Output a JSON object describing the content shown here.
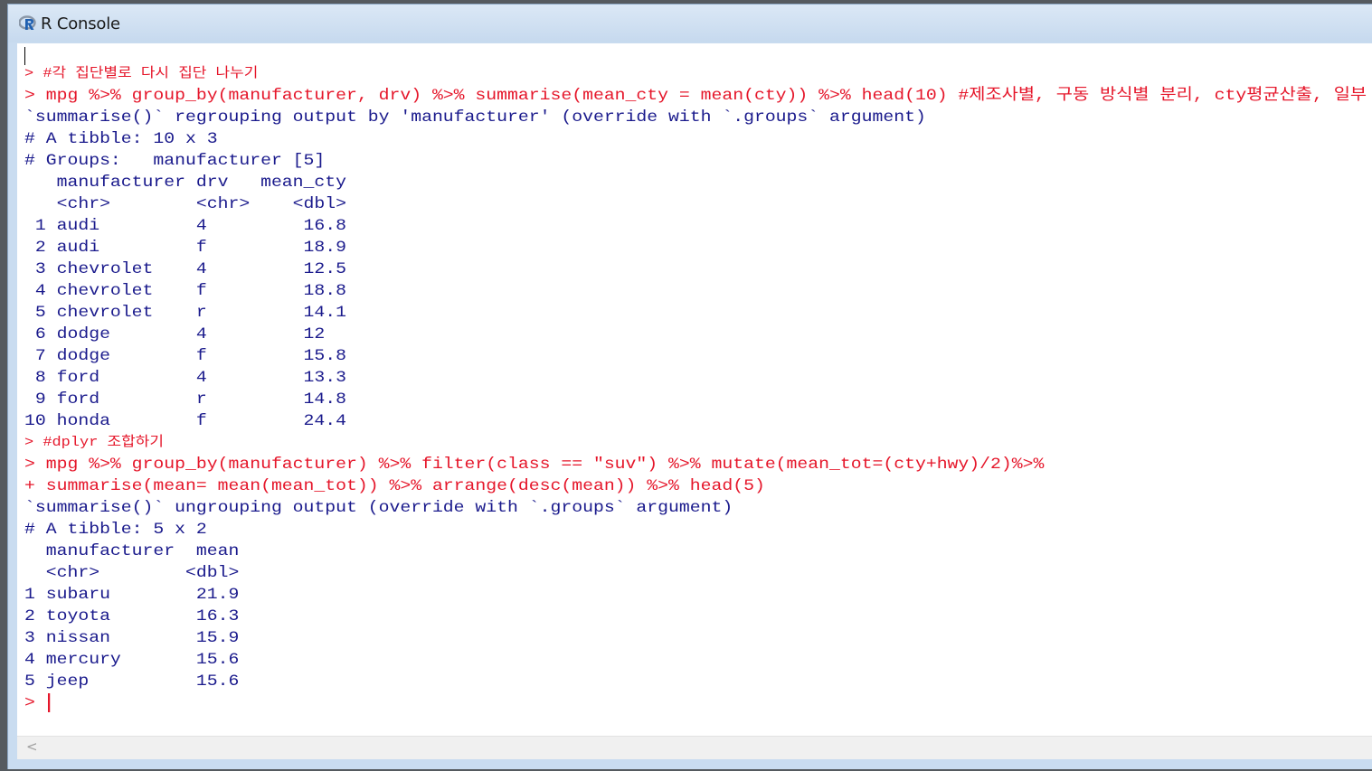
{
  "window": {
    "title": "R Console",
    "icon": "r-logo-icon"
  },
  "console": {
    "lines": [
      {
        "type": "comment",
        "text": "> #각 집단별로 다시 집단 나누기"
      },
      {
        "type": "input",
        "text": "> mpg %>% group_by(manufacturer, drv) %>% summarise(mean_cty = mean(cty)) %>% head(10) #제조사별, 구동 방식별 분리, cty평균산출, 일부 출력"
      },
      {
        "type": "output",
        "text": "`summarise()` regrouping output by 'manufacturer' (override with `.groups` argument)"
      },
      {
        "type": "output",
        "text": "# A tibble: 10 x 3"
      },
      {
        "type": "output",
        "text": "# Groups:   manufacturer [5]"
      },
      {
        "type": "output",
        "text": "   manufacturer drv   mean_cty"
      },
      {
        "type": "output",
        "text": "   <chr>        <chr>    <dbl>"
      },
      {
        "type": "output",
        "text": " 1 audi         4         16.8"
      },
      {
        "type": "output",
        "text": " 2 audi         f         18.9"
      },
      {
        "type": "output",
        "text": " 3 chevrolet    4         12.5"
      },
      {
        "type": "output",
        "text": " 4 chevrolet    f         18.8"
      },
      {
        "type": "output",
        "text": " 5 chevrolet    r         14.1"
      },
      {
        "type": "output",
        "text": " 6 dodge        4         12  "
      },
      {
        "type": "output",
        "text": " 7 dodge        f         15.8"
      },
      {
        "type": "output",
        "text": " 8 ford         4         13.3"
      },
      {
        "type": "output",
        "text": " 9 ford         r         14.8"
      },
      {
        "type": "output",
        "text": "10 honda        f         24.4"
      },
      {
        "type": "comment",
        "text": "> #dplyr 조합하기"
      },
      {
        "type": "input",
        "text": "> mpg %>% group_by(manufacturer) %>% filter(class == \"suv\") %>% mutate(mean_tot=(cty+hwy)/2)%>%"
      },
      {
        "type": "input",
        "text": "+ summarise(mean= mean(mean_tot)) %>% arrange(desc(mean)) %>% head(5)"
      },
      {
        "type": "output",
        "text": "`summarise()` ungrouping output (override with `.groups` argument)"
      },
      {
        "type": "output",
        "text": "# A tibble: 5 x 2"
      },
      {
        "type": "output",
        "text": "  manufacturer  mean"
      },
      {
        "type": "output",
        "text": "  <chr>        <dbl>"
      },
      {
        "type": "output",
        "text": "1 subaru        21.9"
      },
      {
        "type": "output",
        "text": "2 toyota        16.3"
      },
      {
        "type": "output",
        "text": "3 nissan        15.9"
      },
      {
        "type": "output",
        "text": "4 mercury       15.6"
      },
      {
        "type": "output",
        "text": "5 jeep          15.6"
      }
    ],
    "prompt": "> "
  },
  "scrollbar": {
    "left_arrow": "<"
  },
  "colors": {
    "input": "#e5162a",
    "output": "#1a1a8c",
    "frame": "#c9dcf0"
  }
}
